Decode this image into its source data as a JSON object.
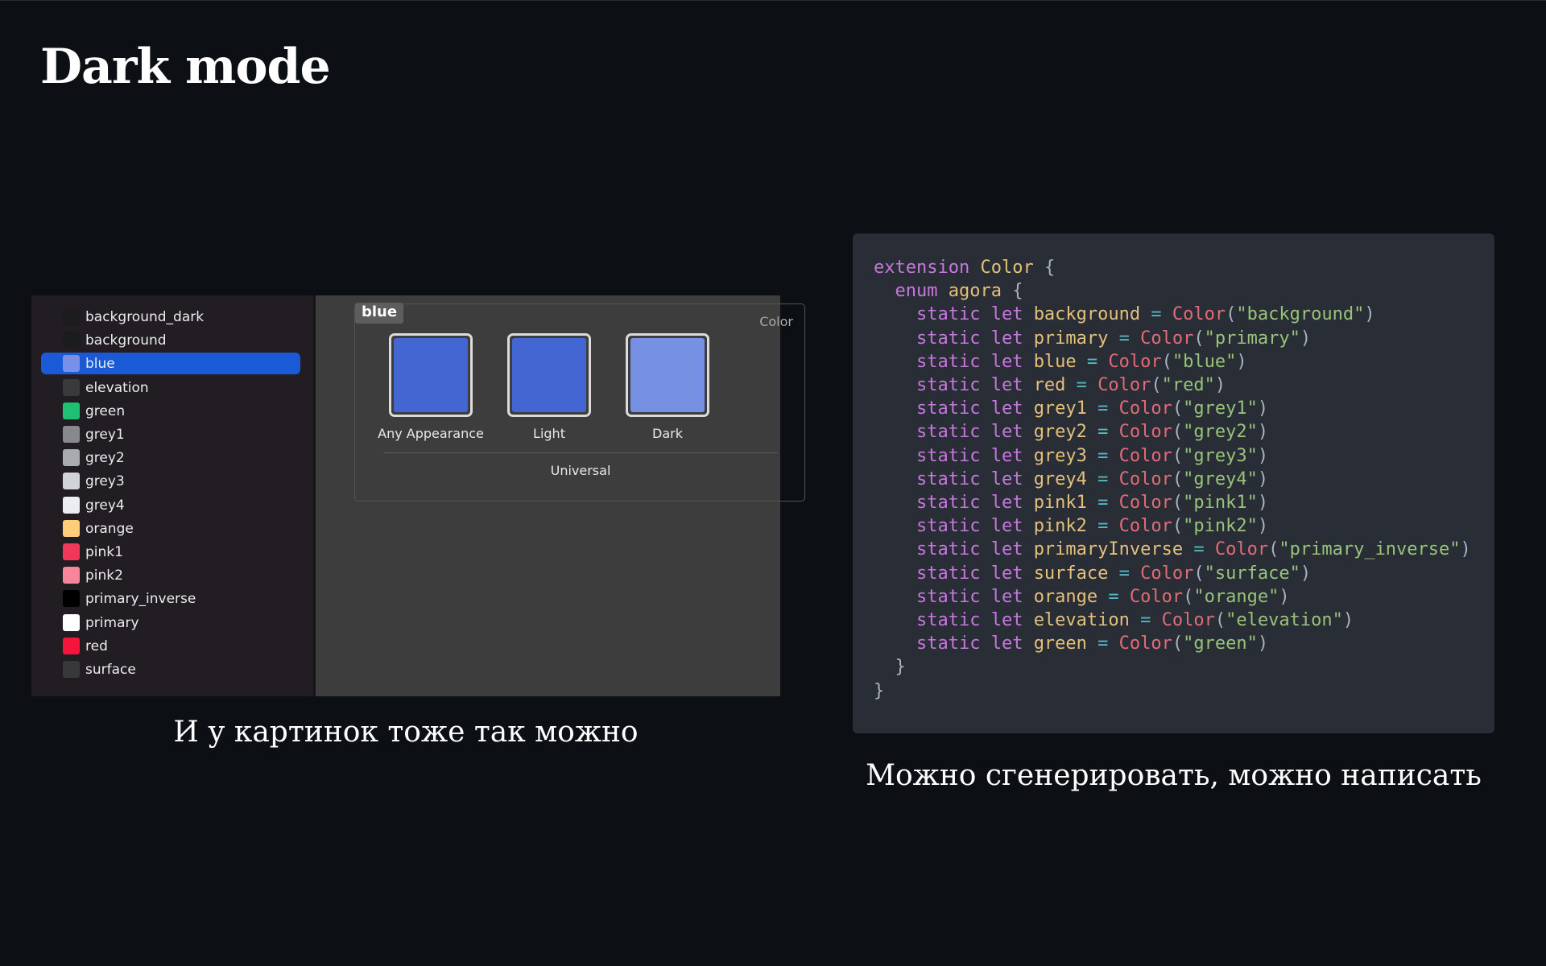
{
  "slide": {
    "title": "Dark mode"
  },
  "assets": {
    "items": [
      {
        "name": "background_dark",
        "swatch": "#1c1c1e"
      },
      {
        "name": "background",
        "swatch": "#1c1c1e"
      },
      {
        "name": "blue",
        "swatch": "#7890e8",
        "selected": true
      },
      {
        "name": "elevation",
        "swatch": "#3a3a3c"
      },
      {
        "name": "green",
        "swatch": "#1fbf74"
      },
      {
        "name": "grey1",
        "swatch": "#88898d"
      },
      {
        "name": "grey2",
        "swatch": "#a9abaf"
      },
      {
        "name": "grey3",
        "swatch": "#d1d3d7"
      },
      {
        "name": "grey4",
        "swatch": "#ebedf2"
      },
      {
        "name": "orange",
        "swatch": "#ffcc7a"
      },
      {
        "name": "pink1",
        "swatch": "#f2385a"
      },
      {
        "name": "pink2",
        "swatch": "#f7869c"
      },
      {
        "name": "primary_inverse",
        "swatch": "#000000"
      },
      {
        "name": "primary",
        "swatch": "#ffffff"
      },
      {
        "name": "red",
        "swatch": "#f5143c"
      },
      {
        "name": "surface",
        "swatch": "#38383a"
      }
    ],
    "detail": {
      "set_name": "blue",
      "set_type": "Color",
      "wells": [
        {
          "label": "Any Appearance",
          "color": "#4466d2"
        },
        {
          "label": "Light",
          "color": "#4466d2"
        },
        {
          "label": "Dark",
          "color": "#7690e4"
        }
      ],
      "group_label": "Universal"
    },
    "caption": "И у картинок тоже так можно"
  },
  "code": {
    "lines": [
      [
        {
          "t": "kw",
          "v": "extension"
        },
        {
          "t": "punc",
          "v": " "
        },
        {
          "t": "type",
          "v": "Color"
        },
        {
          "t": "punc",
          "v": " {"
        }
      ],
      [
        {
          "t": "punc",
          "v": "  "
        },
        {
          "t": "kw",
          "v": "enum"
        },
        {
          "t": "punc",
          "v": " "
        },
        {
          "t": "type",
          "v": "agora"
        },
        {
          "t": "punc",
          "v": " {"
        }
      ],
      [
        {
          "t": "punc",
          "v": "    "
        },
        {
          "t": "kw",
          "v": "static let"
        },
        {
          "t": "punc",
          "v": " "
        },
        {
          "t": "id",
          "v": "background"
        },
        {
          "t": "op",
          "v": " = "
        },
        {
          "t": "fn",
          "v": "Color"
        },
        {
          "t": "punc",
          "v": "("
        },
        {
          "t": "str",
          "v": "\"background\""
        },
        {
          "t": "punc",
          "v": ")"
        }
      ],
      [
        {
          "t": "punc",
          "v": "    "
        },
        {
          "t": "kw",
          "v": "static let"
        },
        {
          "t": "punc",
          "v": " "
        },
        {
          "t": "id",
          "v": "primary"
        },
        {
          "t": "op",
          "v": " = "
        },
        {
          "t": "fn",
          "v": "Color"
        },
        {
          "t": "punc",
          "v": "("
        },
        {
          "t": "str",
          "v": "\"primary\""
        },
        {
          "t": "punc",
          "v": ")"
        }
      ],
      [
        {
          "t": "punc",
          "v": "    "
        },
        {
          "t": "kw",
          "v": "static let"
        },
        {
          "t": "punc",
          "v": " "
        },
        {
          "t": "id",
          "v": "blue"
        },
        {
          "t": "op",
          "v": " = "
        },
        {
          "t": "fn",
          "v": "Color"
        },
        {
          "t": "punc",
          "v": "("
        },
        {
          "t": "str",
          "v": "\"blue\""
        },
        {
          "t": "punc",
          "v": ")"
        }
      ],
      [
        {
          "t": "punc",
          "v": "    "
        },
        {
          "t": "kw",
          "v": "static let"
        },
        {
          "t": "punc",
          "v": " "
        },
        {
          "t": "id",
          "v": "red"
        },
        {
          "t": "op",
          "v": " = "
        },
        {
          "t": "fn",
          "v": "Color"
        },
        {
          "t": "punc",
          "v": "("
        },
        {
          "t": "str",
          "v": "\"red\""
        },
        {
          "t": "punc",
          "v": ")"
        }
      ],
      [
        {
          "t": "punc",
          "v": "    "
        },
        {
          "t": "kw",
          "v": "static let"
        },
        {
          "t": "punc",
          "v": " "
        },
        {
          "t": "id",
          "v": "grey1"
        },
        {
          "t": "op",
          "v": " = "
        },
        {
          "t": "fn",
          "v": "Color"
        },
        {
          "t": "punc",
          "v": "("
        },
        {
          "t": "str",
          "v": "\"grey1\""
        },
        {
          "t": "punc",
          "v": ")"
        }
      ],
      [
        {
          "t": "punc",
          "v": "    "
        },
        {
          "t": "kw",
          "v": "static let"
        },
        {
          "t": "punc",
          "v": " "
        },
        {
          "t": "id",
          "v": "grey2"
        },
        {
          "t": "op",
          "v": " = "
        },
        {
          "t": "fn",
          "v": "Color"
        },
        {
          "t": "punc",
          "v": "("
        },
        {
          "t": "str",
          "v": "\"grey2\""
        },
        {
          "t": "punc",
          "v": ")"
        }
      ],
      [
        {
          "t": "punc",
          "v": "    "
        },
        {
          "t": "kw",
          "v": "static let"
        },
        {
          "t": "punc",
          "v": " "
        },
        {
          "t": "id",
          "v": "grey3"
        },
        {
          "t": "op",
          "v": " = "
        },
        {
          "t": "fn",
          "v": "Color"
        },
        {
          "t": "punc",
          "v": "("
        },
        {
          "t": "str",
          "v": "\"grey3\""
        },
        {
          "t": "punc",
          "v": ")"
        }
      ],
      [
        {
          "t": "punc",
          "v": "    "
        },
        {
          "t": "kw",
          "v": "static let"
        },
        {
          "t": "punc",
          "v": " "
        },
        {
          "t": "id",
          "v": "grey4"
        },
        {
          "t": "op",
          "v": " = "
        },
        {
          "t": "fn",
          "v": "Color"
        },
        {
          "t": "punc",
          "v": "("
        },
        {
          "t": "str",
          "v": "\"grey4\""
        },
        {
          "t": "punc",
          "v": ")"
        }
      ],
      [
        {
          "t": "punc",
          "v": "    "
        },
        {
          "t": "kw",
          "v": "static let"
        },
        {
          "t": "punc",
          "v": " "
        },
        {
          "t": "id",
          "v": "pink1"
        },
        {
          "t": "op",
          "v": " = "
        },
        {
          "t": "fn",
          "v": "Color"
        },
        {
          "t": "punc",
          "v": "("
        },
        {
          "t": "str",
          "v": "\"pink1\""
        },
        {
          "t": "punc",
          "v": ")"
        }
      ],
      [
        {
          "t": "punc",
          "v": "    "
        },
        {
          "t": "kw",
          "v": "static let"
        },
        {
          "t": "punc",
          "v": " "
        },
        {
          "t": "id",
          "v": "pink2"
        },
        {
          "t": "op",
          "v": " = "
        },
        {
          "t": "fn",
          "v": "Color"
        },
        {
          "t": "punc",
          "v": "("
        },
        {
          "t": "str",
          "v": "\"pink2\""
        },
        {
          "t": "punc",
          "v": ")"
        }
      ],
      [
        {
          "t": "punc",
          "v": "    "
        },
        {
          "t": "kw",
          "v": "static let"
        },
        {
          "t": "punc",
          "v": " "
        },
        {
          "t": "id",
          "v": "primaryInverse"
        },
        {
          "t": "op",
          "v": " = "
        },
        {
          "t": "fn",
          "v": "Color"
        },
        {
          "t": "punc",
          "v": "("
        },
        {
          "t": "str",
          "v": "\"primary_inverse\""
        },
        {
          "t": "punc",
          "v": ")"
        }
      ],
      [
        {
          "t": "punc",
          "v": "    "
        },
        {
          "t": "kw",
          "v": "static let"
        },
        {
          "t": "punc",
          "v": " "
        },
        {
          "t": "id",
          "v": "surface"
        },
        {
          "t": "op",
          "v": " = "
        },
        {
          "t": "fn",
          "v": "Color"
        },
        {
          "t": "punc",
          "v": "("
        },
        {
          "t": "str",
          "v": "\"surface\""
        },
        {
          "t": "punc",
          "v": ")"
        }
      ],
      [
        {
          "t": "punc",
          "v": "    "
        },
        {
          "t": "kw",
          "v": "static let"
        },
        {
          "t": "punc",
          "v": " "
        },
        {
          "t": "id",
          "v": "orange"
        },
        {
          "t": "op",
          "v": " = "
        },
        {
          "t": "fn",
          "v": "Color"
        },
        {
          "t": "punc",
          "v": "("
        },
        {
          "t": "str",
          "v": "\"orange\""
        },
        {
          "t": "punc",
          "v": ")"
        }
      ],
      [
        {
          "t": "punc",
          "v": "    "
        },
        {
          "t": "kw",
          "v": "static let"
        },
        {
          "t": "punc",
          "v": " "
        },
        {
          "t": "id",
          "v": "elevation"
        },
        {
          "t": "op",
          "v": " = "
        },
        {
          "t": "fn",
          "v": "Color"
        },
        {
          "t": "punc",
          "v": "("
        },
        {
          "t": "str",
          "v": "\"elevation\""
        },
        {
          "t": "punc",
          "v": ")"
        }
      ],
      [
        {
          "t": "punc",
          "v": "    "
        },
        {
          "t": "kw",
          "v": "static let"
        },
        {
          "t": "punc",
          "v": " "
        },
        {
          "t": "id",
          "v": "green"
        },
        {
          "t": "op",
          "v": " = "
        },
        {
          "t": "fn",
          "v": "Color"
        },
        {
          "t": "punc",
          "v": "("
        },
        {
          "t": "str",
          "v": "\"green\""
        },
        {
          "t": "punc",
          "v": ")"
        }
      ],
      [
        {
          "t": "punc",
          "v": "  }"
        }
      ],
      [
        {
          "t": "punc",
          "v": "}"
        }
      ]
    ],
    "caption": "Можно сгенерировать, можно написать"
  }
}
